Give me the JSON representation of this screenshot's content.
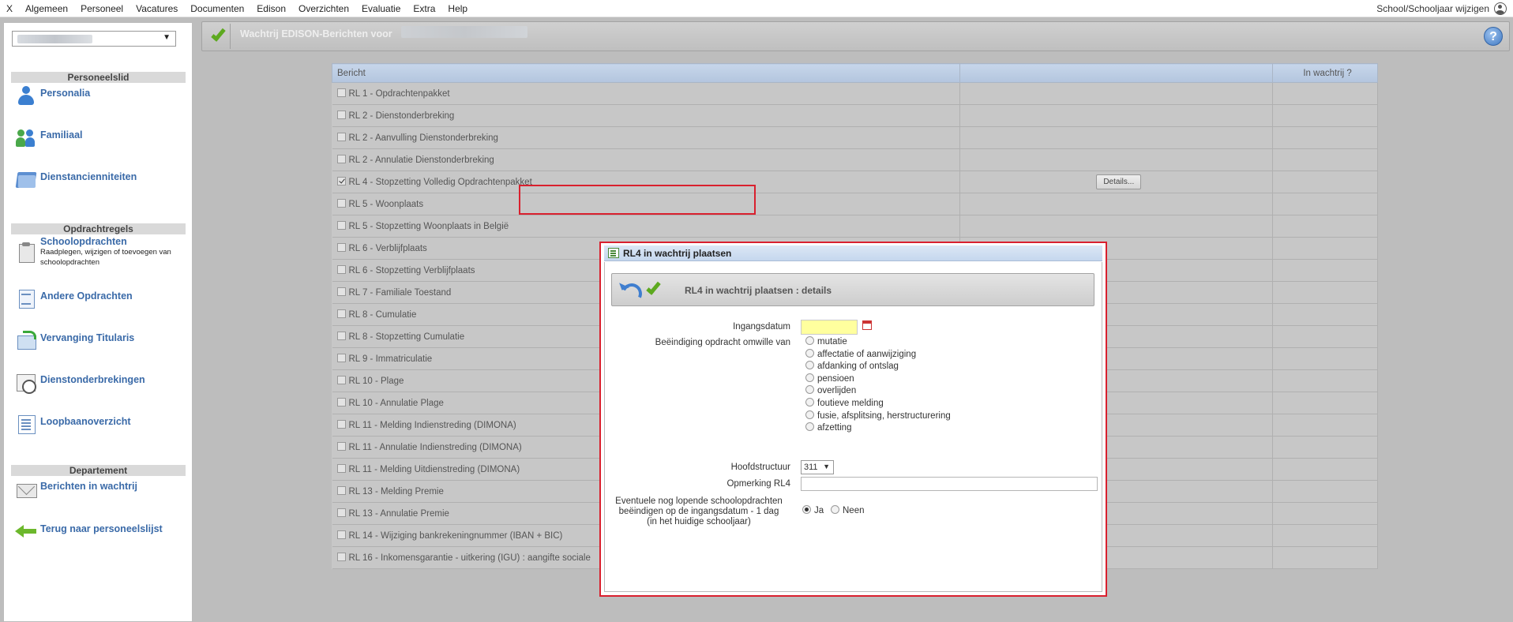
{
  "menu": {
    "close": "X",
    "items": [
      "Algemeen",
      "Personeel",
      "Vacatures",
      "Documenten",
      "Edison",
      "Overzichten",
      "Evaluatie",
      "Extra",
      "Help"
    ],
    "right_label": "School/Schooljaar wijzigen"
  },
  "sidebar": {
    "sections": {
      "personeelslid": "Personeelslid",
      "opdrachtregels": "Opdrachtregels",
      "departement": "Departement"
    },
    "items": {
      "personalia": "Personalia",
      "familiaal": "Familiaal",
      "dienstanciënniteiten": "Dienstancienniteiten",
      "schoolopdrachten": "Schoolopdrachten",
      "schoolopdrachten_sub": "Raadplegen, wijzigen of toevoegen van schoolopdrachten",
      "andere_opdrachten": "Andere Opdrachten",
      "vervanging_titularis": "Vervanging Titularis",
      "dienstonderbrekingen": "Dienstonderbrekingen",
      "loopbaanoverzicht": "Loopbaanoverzicht",
      "berichten_in_wachtrij": "Berichten in wachtrij",
      "terug": "Terug naar personeelslijst"
    }
  },
  "toolbar": {
    "title": "Wachtrij EDISON-Berichten voor",
    "help": "?"
  },
  "table": {
    "headers": [
      "Bericht",
      "",
      "In wachtrij ?"
    ],
    "rows": [
      {
        "label": "RL 1 - Opdrachtenpakket",
        "checked": false
      },
      {
        "label": "RL 2 - Dienstonderbreking",
        "checked": false
      },
      {
        "label": "RL 2 - Aanvulling Dienstonderbreking",
        "checked": false
      },
      {
        "label": "RL 2 - Annulatie Dienstonderbreking",
        "checked": false
      },
      {
        "label": "RL 4 - Stopzetting Volledig Opdrachtenpakket",
        "checked": true,
        "details": "Details..."
      },
      {
        "label": "RL 5 - Woonplaats",
        "checked": false
      },
      {
        "label": "RL 5 - Stopzetting Woonplaats in België",
        "checked": false
      },
      {
        "label": "RL 6 - Verblijfplaats",
        "checked": false
      },
      {
        "label": "RL 6 - Stopzetting Verblijfplaats",
        "checked": false
      },
      {
        "label": "RL 7 - Familiale Toestand",
        "checked": false
      },
      {
        "label": "RL 8 - Cumulatie",
        "checked": false
      },
      {
        "label": "RL 8 - Stopzetting Cumulatie",
        "checked": false
      },
      {
        "label": "RL 9 - Immatriculatie",
        "checked": false
      },
      {
        "label": "RL 10 - Plage",
        "checked": false
      },
      {
        "label": "RL 10 - Annulatie Plage",
        "checked": false
      },
      {
        "label": "RL 11 - Melding Indienstreding (DIMONA)",
        "checked": false
      },
      {
        "label": "RL 11 - Annulatie Indienstreding (DIMONA)",
        "checked": false
      },
      {
        "label": "RL 11 - Melding Uitdienstreding (DIMONA)",
        "checked": false
      },
      {
        "label": "RL 13 - Melding Premie",
        "checked": false
      },
      {
        "label": "RL 13 - Annulatie Premie",
        "checked": false
      },
      {
        "label": "RL 14 - Wijziging bankrekeningnummer (IBAN + BIC)",
        "checked": false
      },
      {
        "label": "RL 16 - Inkomensgarantie - uitkering (IGU) : aangifte sociale",
        "checked": false
      }
    ]
  },
  "dialog": {
    "title": "RL4 in wachtrij plaatsen",
    "toolbar_title": "RL4 in wachtrij plaatsen : details",
    "labels": {
      "ingangsdatum": "Ingangsdatum",
      "beeindiging": "Beëindiging opdracht omwille van",
      "hoofdstructuur": "Hoofdstructuur",
      "opmerking": "Opmerking RL4",
      "eventueel_l1": "Eventuele nog lopende schoolopdrachten",
      "eventueel_l2": "beëindigen op de ingangsdatum  - 1 dag",
      "eventueel_l3": "(in het huidige schooljaar)"
    },
    "ingangsdatum_value": "",
    "reasons": [
      "mutatie",
      "affectatie of aanwijziging",
      "afdanking of ontslag",
      "pensioen",
      "overlijden",
      "foutieve melding",
      "fusie, afsplitsing, herstructurering",
      "afzetting"
    ],
    "hoofdstructuur_value": "311",
    "opmerking_value": "",
    "ja": "Ja",
    "neen": "Neen",
    "selected_end": "Ja"
  },
  "colors": {
    "accent": "#3a6aa8",
    "highlight": "#d9202e",
    "date_field": "#ffff9e"
  }
}
